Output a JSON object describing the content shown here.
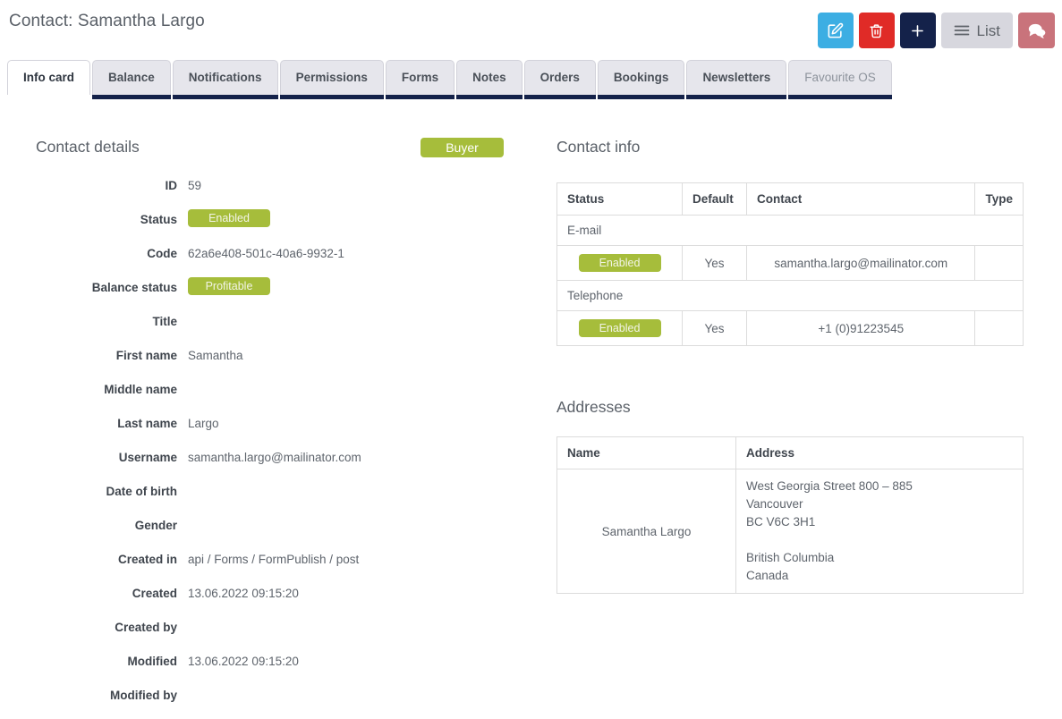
{
  "header": {
    "title": "Contact: Samantha Largo",
    "toolbar": [
      {
        "name": "edit-button",
        "icon": "edit-icon",
        "label": "",
        "color": "#3caee3"
      },
      {
        "name": "delete-button",
        "icon": "trash-icon",
        "label": "",
        "color": "#e02b27"
      },
      {
        "name": "add-button",
        "icon": "plus-icon",
        "label": "",
        "color": "#14224a"
      },
      {
        "name": "list-button",
        "icon": "hamburger-icon",
        "label": "List",
        "color": "#d7d7de"
      },
      {
        "name": "chat-button",
        "icon": "chat-icon",
        "label": "",
        "color": "#c9737b"
      }
    ],
    "list_label": "List"
  },
  "tabs": [
    {
      "label": "Info card",
      "active": true,
      "muted": false
    },
    {
      "label": "Balance",
      "active": false,
      "muted": false
    },
    {
      "label": "Notifications",
      "active": false,
      "muted": false
    },
    {
      "label": "Permissions",
      "active": false,
      "muted": false
    },
    {
      "label": "Forms",
      "active": false,
      "muted": false
    },
    {
      "label": "Notes",
      "active": false,
      "muted": false
    },
    {
      "label": "Orders",
      "active": false,
      "muted": false
    },
    {
      "label": "Bookings",
      "active": false,
      "muted": false
    },
    {
      "label": "Newsletters",
      "active": false,
      "muted": false
    },
    {
      "label": "Favourite OS",
      "active": false,
      "muted": true
    }
  ],
  "contact_details": {
    "title": "Contact details",
    "buyer_badge": "Buyer",
    "rows": [
      {
        "label": "ID",
        "value": "59",
        "type": "text"
      },
      {
        "label": "Status",
        "value": "Enabled",
        "type": "pill"
      },
      {
        "label": "Code",
        "value": "62a6e408-501c-40a6-9932-1",
        "type": "text"
      },
      {
        "label": "Balance status",
        "value": "Profitable",
        "type": "pill"
      },
      {
        "label": "Title",
        "value": "",
        "type": "text"
      },
      {
        "label": "First name",
        "value": "Samantha",
        "type": "text"
      },
      {
        "label": "Middle name",
        "value": "",
        "type": "text"
      },
      {
        "label": "Last name",
        "value": "Largo",
        "type": "text"
      },
      {
        "label": "Username",
        "value": "samantha.largo@mailinator.com",
        "type": "text"
      },
      {
        "label": "Date of birth",
        "value": "",
        "type": "text"
      },
      {
        "label": "Gender",
        "value": "",
        "type": "text"
      },
      {
        "label": "Created in",
        "value": "api / Forms / FormPublish / post",
        "type": "text"
      },
      {
        "label": "Created",
        "value": "13.06.2022 09:15:20",
        "type": "text"
      },
      {
        "label": "Created by",
        "value": "",
        "type": "text"
      },
      {
        "label": "Modified",
        "value": "13.06.2022 09:15:20",
        "type": "text"
      },
      {
        "label": "Modified by",
        "value": "",
        "type": "text"
      }
    ]
  },
  "contact_info": {
    "title": "Contact info",
    "columns": [
      "Status",
      "Default",
      "Contact",
      "Type"
    ],
    "groups": [
      {
        "name": "E-mail",
        "rows": [
          {
            "status": "Enabled",
            "default": "Yes",
            "contact": "samantha.largo@mailinator.com",
            "type": ""
          }
        ]
      },
      {
        "name": "Telephone",
        "rows": [
          {
            "status": "Enabled",
            "default": "Yes",
            "contact": "+1 (0)91223545",
            "type": ""
          }
        ]
      }
    ]
  },
  "addresses": {
    "title": "Addresses",
    "columns": [
      "Name",
      "Address"
    ],
    "rows": [
      {
        "name": "Samantha Largo",
        "line1": "West Georgia Street 800 – 885",
        "line2": "Vancouver",
        "line3": "BC V6C 3H1",
        "line4": "British Columbia",
        "line5": "Canada"
      }
    ]
  },
  "colors": {
    "green_badge": "#a6bd3b",
    "navy": "#14224a",
    "edit_blue": "#3caee3",
    "delete_red": "#e02b27",
    "chat_rose": "#c9737b",
    "tab_gray": "#e6e6ec"
  }
}
